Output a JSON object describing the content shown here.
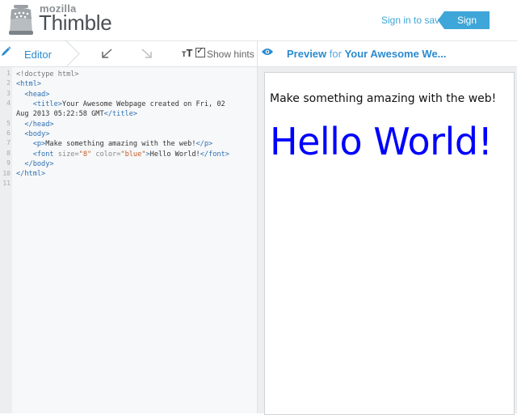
{
  "header": {
    "logo_small": "mozilla",
    "logo_big": "Thimble",
    "sign_in": "Sign in to save",
    "sign_up": "Sign up"
  },
  "toolbar": {
    "editor_tab": "Editor",
    "tt_small": "T",
    "tt_big": "T",
    "show_hints": "Show hints",
    "preview_label": "Preview",
    "preview_for": " for ",
    "preview_title": "Your Awesome We..."
  },
  "editor": {
    "line_numbers": [
      "1",
      "2",
      "3",
      "4",
      "5",
      "6",
      "7",
      "8",
      "9",
      "10",
      "11"
    ]
  },
  "code": {
    "l1": "<!doctype html>",
    "l2_tag": "<html>",
    "l3_tag": "<head>",
    "l4_open": "<title>",
    "l4_text": "Your Awesome Webpage created on Fri, 02",
    "l4b_text": "Aug 2013 05:22:58 GMT",
    "l4_close": "</title>",
    "l5_tag": "</head>",
    "l6_tag": "<body>",
    "l7_open": "<p>",
    "l7_text": "Make something amazing with the web!",
    "l7_close": "</p>",
    "l8_open": "<font",
    "l8_size_attr": "size=",
    "l8_size_val": "\"8\"",
    "l8_color_attr": "color=",
    "l8_color_val": "\"blue\"",
    "l8_gt": ">",
    "l8_text": "Hello World!",
    "l8_close": "</font>",
    "l9_tag": "</body>",
    "l10_tag": "</html>"
  },
  "preview": {
    "paragraph": "Make something amazing with the web!",
    "hello": "Hello World!",
    "hello_color": "#0000ff"
  },
  "colors": {
    "accent": "#3ea6d8",
    "tag": "#2b6fb3",
    "string": "#c15b27"
  },
  "icons": [
    "thimble-logo-icon",
    "pencil-icon",
    "undo-icon",
    "redo-icon",
    "checkbox-icon",
    "eye-icon"
  ]
}
